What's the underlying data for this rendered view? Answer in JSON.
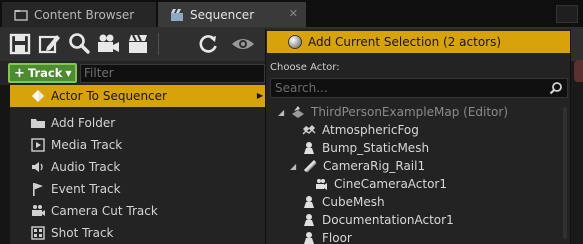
{
  "tabs": [
    {
      "label": "Content Browser",
      "icon": "content-browser-icon"
    },
    {
      "label": "Sequencer",
      "icon": "sequencer-icon"
    }
  ],
  "toolbar": {
    "icons": [
      "save-icon",
      "save-as-icon",
      "find-icon",
      "render-movie-icon",
      "cinematics-icon",
      "refresh-icon",
      "eye-icon"
    ]
  },
  "track": {
    "button_label": "Track",
    "filter_placeholder": "Filter"
  },
  "left_menu": {
    "items": [
      {
        "label": "Actor To Sequencer",
        "icon": "actor-icon",
        "selected": true,
        "submenu": true
      },
      {
        "label": "Add Folder",
        "icon": "folder-icon"
      },
      {
        "label": "Media Track",
        "icon": "media-icon"
      },
      {
        "label": "Audio Track",
        "icon": "audio-icon"
      },
      {
        "label": "Event Track",
        "icon": "event-flag-icon"
      },
      {
        "label": "Camera Cut Track",
        "icon": "camera-cut-icon"
      },
      {
        "label": "Shot Track",
        "icon": "shot-icon"
      }
    ]
  },
  "popup": {
    "add_selection_label": "Add Current Selection (2 actors)",
    "choose_label": "Choose Actor:",
    "search_placeholder": "Search...",
    "tree": [
      {
        "label": "ThirdPersonExampleMap (Editor)",
        "icon": "world-icon",
        "depth": 0,
        "expanded": true,
        "dim": true
      },
      {
        "label": "AtmosphericFog",
        "icon": "fog-icon",
        "depth": 1
      },
      {
        "label": "Bump_StaticMesh",
        "icon": "pawn-icon",
        "depth": 1
      },
      {
        "label": "CameraRig_Rail1",
        "icon": "rail-icon",
        "depth": 1,
        "expanded": true
      },
      {
        "label": "CineCameraActor1",
        "icon": "cine-camera-icon",
        "depth": 2
      },
      {
        "label": "CubeMesh",
        "icon": "pawn-icon",
        "depth": 1
      },
      {
        "label": "DocumentationActor1",
        "icon": "pawn-icon",
        "depth": 1
      },
      {
        "label": "Floor",
        "icon": "pawn-icon",
        "depth": 1
      }
    ]
  },
  "colors": {
    "accent": "#d8a209",
    "track_button": "#4d8b30",
    "track_border": "#7ec94e"
  }
}
